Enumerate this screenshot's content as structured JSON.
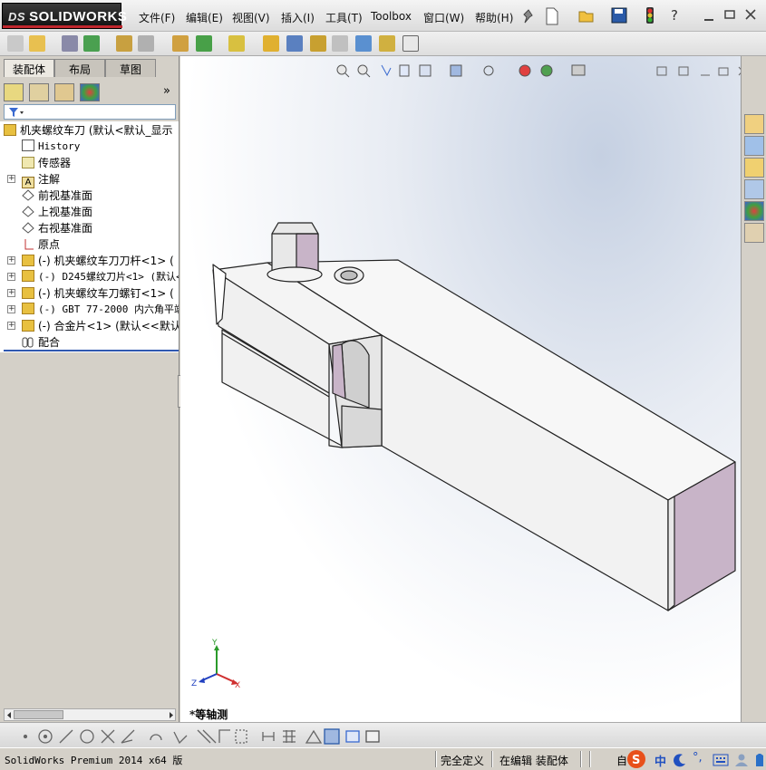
{
  "app": {
    "name": "SOLIDWORKS",
    "brand": "DS"
  },
  "menu": [
    "文件(F)",
    "编辑(E)",
    "视图(V)",
    "插入(I)",
    "工具(T)",
    "Toolbox",
    "窗口(W)",
    "帮助(H)"
  ],
  "panel_tabs": [
    "装配体",
    "布局",
    "草图"
  ],
  "tree": {
    "root": "机夹螺纹车刀  (默认<默认_显示",
    "items": [
      {
        "label": "History",
        "icon": "history-icon",
        "mono": true
      },
      {
        "label": "传感器",
        "icon": "sensor-icon"
      },
      {
        "label": "注解",
        "icon": "annotation-icon",
        "expandable": true
      },
      {
        "label": "前视基准面",
        "icon": "plane-icon"
      },
      {
        "label": "上视基准面",
        "icon": "plane-icon"
      },
      {
        "label": "右视基准面",
        "icon": "plane-icon"
      },
      {
        "label": "原点",
        "icon": "origin-icon"
      },
      {
        "label": "(-) 机夹螺纹车刀刀杆<1> (",
        "icon": "part-icon",
        "expandable": true
      },
      {
        "label": "(-) D245螺纹刀片<1> (默认<",
        "icon": "part-icon",
        "expandable": true,
        "mono": true
      },
      {
        "label": "(-) 机夹螺纹车刀螺钉<1> (",
        "icon": "part-icon",
        "expandable": true
      },
      {
        "label": "(-) GBT 77-2000 内六角平端",
        "icon": "part-icon",
        "expandable": true,
        "mono": true
      },
      {
        "label": "(-) 合金片<1> (默认<<默认",
        "icon": "part-icon",
        "expandable": true
      },
      {
        "label": "配合",
        "icon": "mates-icon"
      }
    ]
  },
  "viewport": {
    "view_name": "*等轴测",
    "axes": {
      "x": "X",
      "y": "Y",
      "z": "Z"
    }
  },
  "status": {
    "product": "SolidWorks Premium 2014 x64 版",
    "state": "完全定义",
    "mode": "在编辑 装配体",
    "custom": "自"
  },
  "ime": {
    "label": "中"
  },
  "colors": {
    "accent": "#3058b0",
    "logo_red": "#c0262d",
    "part_face": "#c8b4c8"
  }
}
